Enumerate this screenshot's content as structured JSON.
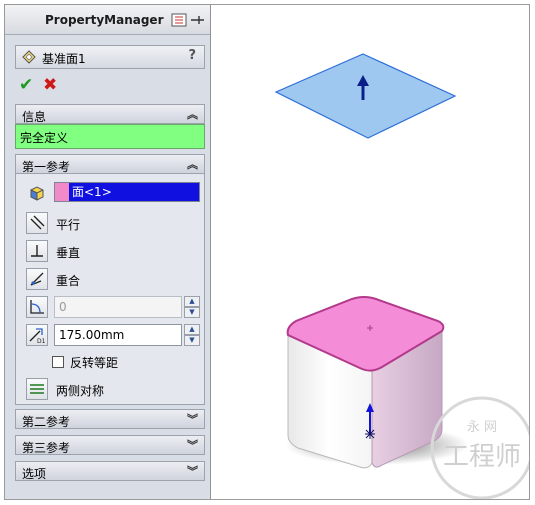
{
  "panel": {
    "title": "PropertyManager",
    "feature_name": "基准面1",
    "help": "?",
    "ok_glyph": "✔",
    "cancel_glyph": "✖"
  },
  "info": {
    "header": "信息",
    "status": "完全定义",
    "status_color": "#80ff80"
  },
  "first_reference": {
    "header": "第一参考",
    "selection": "面<1>",
    "parallel": "平行",
    "perpendicular": "垂直",
    "coincident": "重合",
    "angle_value": "0",
    "distance_value": "175.00mm",
    "flip_offset": "反转等距",
    "mid_plane": "两侧对称"
  },
  "collapsed_groups": {
    "second_reference": "第二参考",
    "third_reference": "第三参考",
    "options": "选项"
  },
  "icons": [
    "feature-plane-icon",
    "ok-check-icon",
    "cancel-x-icon",
    "collapse-icon",
    "expand-icon",
    "face-select-icon",
    "parallel-icon",
    "perpendicular-icon",
    "coincident-icon",
    "angle-icon",
    "distance-icon",
    "mid-plane-icon"
  ],
  "colors": {
    "plane_fill": "#9fc8f0",
    "plane_edge": "#2d6fd8",
    "selected_face": "#f58cd8",
    "selection_highlight": "#1010e0",
    "ok": "#1e9a1e",
    "cancel": "#d01818"
  },
  "watermark": {
    "top_text": "永 网",
    "main_text": "工程师"
  }
}
